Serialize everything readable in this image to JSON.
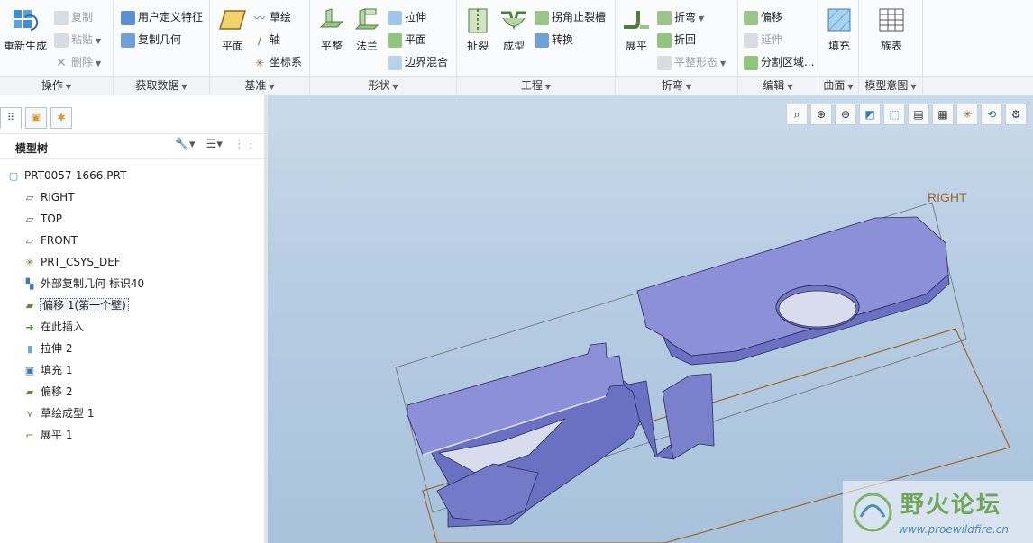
{
  "ribbon": {
    "ops": {
      "regen": "重新生成",
      "copy": "复制",
      "paste": "粘贴",
      "delete": "删除"
    },
    "getdata": {
      "udf": "用户定义特征",
      "copygeom": "复制几何"
    },
    "datum": {
      "plane": "平面",
      "sketch": "草绘",
      "axis": "轴",
      "csys": "坐标系"
    },
    "shape": {
      "flat": "平整",
      "flange": "法兰",
      "extrude": "拉伸",
      "plane": "平面",
      "blend": "边界混合"
    },
    "eng": {
      "rip": "扯裂",
      "form": "成型",
      "corner": "拐角止裂槽",
      "convert": "转换"
    },
    "bend": {
      "unbend": "展平",
      "bend": "折弯",
      "bendback": "折回",
      "flatform": "平整形态"
    },
    "edit": {
      "offset": "偏移",
      "extend": "延伸",
      "split": "分割区域..."
    },
    "surface": {
      "fill": "填充"
    },
    "intent": {
      "table": "族表"
    },
    "groups": {
      "ops": "操作",
      "getdata": "获取数据",
      "datum": "基准",
      "shape": "形状",
      "eng": "工程",
      "bend": "折弯",
      "edit": "编辑",
      "surface": "曲面",
      "intent": "模型意图"
    }
  },
  "panel": {
    "title": "模型树",
    "items": [
      {
        "label": "PRT0057-1666.PRT",
        "icon": "part-icon"
      },
      {
        "label": "RIGHT",
        "icon": "datum-plane-icon"
      },
      {
        "label": "TOP",
        "icon": "datum-plane-icon"
      },
      {
        "label": "FRONT",
        "icon": "datum-plane-icon"
      },
      {
        "label": "PRT_CSYS_DEF",
        "icon": "csys-icon"
      },
      {
        "label": "外部复制几何 标识40",
        "icon": "copy-geom-icon"
      },
      {
        "label": "偏移 1(第一个壁)",
        "icon": "offset-icon"
      },
      {
        "label": "在此插入",
        "icon": "insert-arrow-icon"
      },
      {
        "label": "拉伸 2",
        "icon": "extrude-icon"
      },
      {
        "label": "填充 1",
        "icon": "fill-icon"
      },
      {
        "label": "偏移 2",
        "icon": "offset-icon"
      },
      {
        "label": "草绘成型 1",
        "icon": "sketch-form-icon"
      },
      {
        "label": "展平 1",
        "icon": "unbend-icon"
      }
    ]
  },
  "viewport": {
    "datum_label": "RIGHT",
    "watermark_title": "野火论坛",
    "watermark_url": "www.proewildfire.cn"
  },
  "colors": {
    "part_top": "#8b90d8",
    "part_side": "#6a70c2",
    "datum_frame": "#a06828"
  }
}
